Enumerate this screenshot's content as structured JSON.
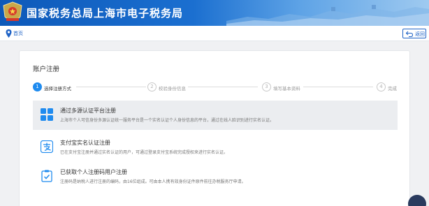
{
  "header": {
    "title": "国家税务总局上海市电子税务局",
    "emblem_icon": "tax-emblem-icon"
  },
  "breadcrumb": {
    "home_label": "首页",
    "pin_icon": "location-pin-icon"
  },
  "back_button": {
    "label": "返回",
    "icon": "return-arrow-icon"
  },
  "card": {
    "title": "账户注册"
  },
  "steps": [
    {
      "num": "1",
      "label": "选择注册方式",
      "active": true
    },
    {
      "num": "2",
      "label": "校验身份信息",
      "active": false
    },
    {
      "num": "3",
      "label": "填写基本资料",
      "active": false
    },
    {
      "num": "4",
      "label": "完成",
      "active": false
    }
  ],
  "options": [
    {
      "title": "通过多源认证平台注册",
      "desc": "上海市个人可信身份多源认证统一服务平台是一个实名认证个人身份信息的平台，通过在线人脸识别进行实名认证。",
      "icon": "app-grid-icon",
      "selected": true
    },
    {
      "title": "支付宝实名认证注册",
      "desc": "已在支付宝注册并通过实名认证的用户，可通过登录支付宝系统完成授权来进行实名认证。",
      "icon": "alipay-icon",
      "selected": false
    },
    {
      "title": "已获取个人注册码用户注册",
      "desc": "注册码是纳税人进行注册的编码，由16位组成。可由本人携有效身份证件原件前往办税服务厅申请。",
      "icon": "registration-code-icon",
      "selected": false
    }
  ],
  "colors": {
    "brand_blue": "#1f63c6",
    "step_active": "#1f8bef",
    "option_icon": "#1f8bef",
    "header_blue": "#0d59b9"
  }
}
